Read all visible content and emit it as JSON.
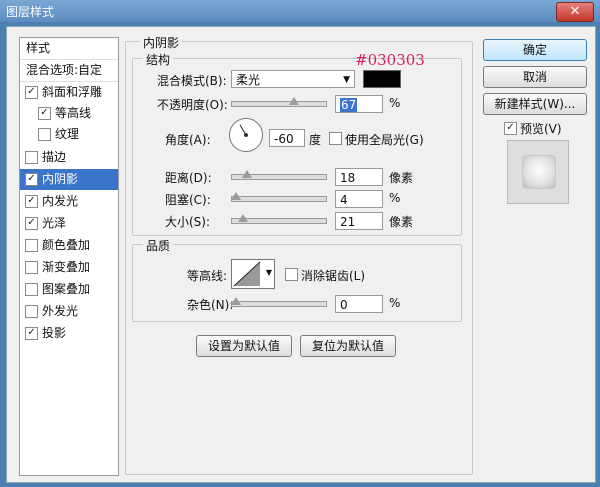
{
  "window": {
    "title": "图层样式",
    "close": "✕"
  },
  "sidebar": {
    "header": "样式",
    "blend_options": "混合选项:自定",
    "items": [
      {
        "label": "斜面和浮雕",
        "checked": true
      },
      {
        "label": "等高线",
        "checked": true
      },
      {
        "label": "纹理",
        "checked": false
      },
      {
        "label": "描边",
        "checked": false
      },
      {
        "label": "内阴影",
        "checked": true
      },
      {
        "label": "内发光",
        "checked": true
      },
      {
        "label": "光泽",
        "checked": true
      },
      {
        "label": "颜色叠加",
        "checked": false
      },
      {
        "label": "渐变叠加",
        "checked": false
      },
      {
        "label": "图案叠加",
        "checked": false
      },
      {
        "label": "外发光",
        "checked": false
      },
      {
        "label": "投影",
        "checked": true
      }
    ]
  },
  "panel": {
    "title": "内阴影",
    "structure_title": "结构",
    "blend_mode_label": "混合模式(B):",
    "blend_mode_value": "柔光",
    "annotation": "#030303",
    "opacity_label": "不透明度(O):",
    "opacity_value": "67",
    "angle_label": "角度(A):",
    "angle_value": "-60",
    "angle_unit": "度",
    "global_light_label": "使用全局光(G)",
    "distance_label": "距离(D):",
    "distance_value": "18",
    "choke_label": "阻塞(C):",
    "choke_value": "4",
    "size_label": "大小(S):",
    "size_value": "21",
    "unit_px": "像素",
    "unit_pct": "%",
    "quality_title": "品质",
    "contour_label": "等高线:",
    "antialias_label": "消除锯齿(L)",
    "noise_label": "杂色(N):",
    "noise_value": "0",
    "set_default": "设置为默认值",
    "reset_default": "复位为默认值"
  },
  "buttons": {
    "ok": "确定",
    "cancel": "取消",
    "new_style": "新建样式(W)...",
    "preview_label": "预览(V)"
  },
  "colors": {
    "shadow_color": "#030303",
    "annotation_color": "#d6235a",
    "selection": "#3b74c9"
  },
  "slider_levels": {
    "opacity_pct": 67,
    "distance_pct": 15,
    "choke_pct": 4,
    "size_pct": 12,
    "noise_pct": 0
  }
}
